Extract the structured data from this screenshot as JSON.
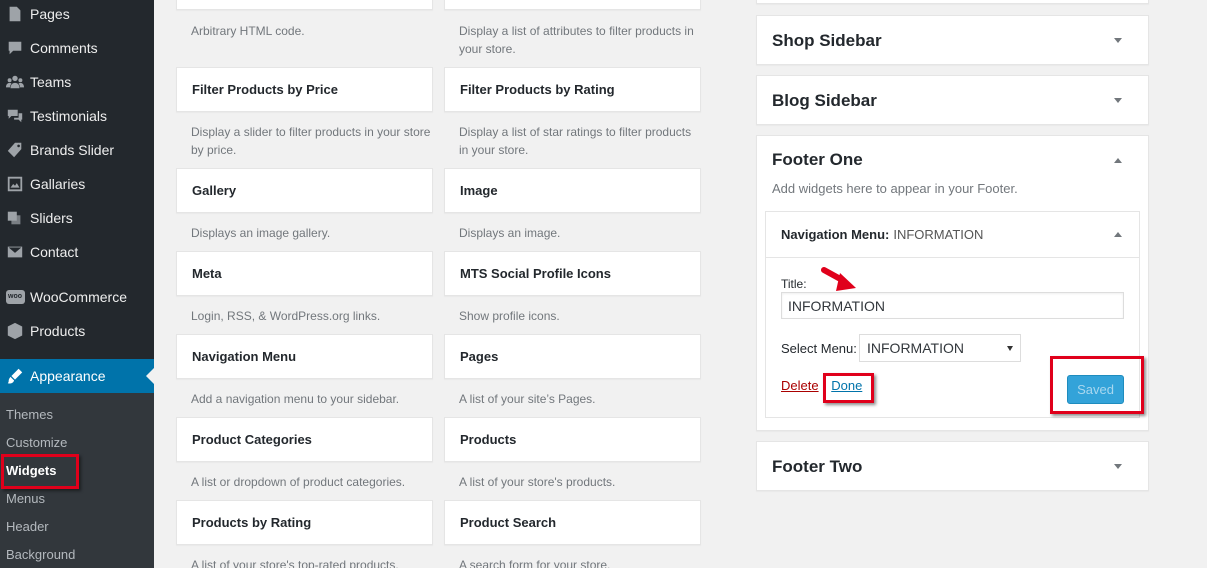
{
  "sidebar": {
    "items": [
      {
        "label": "Pages",
        "icon": "pages-icon"
      },
      {
        "label": "Comments",
        "icon": "comments-icon"
      },
      {
        "label": "Teams",
        "icon": "teams-icon"
      },
      {
        "label": "Testimonials",
        "icon": "testimonials-icon"
      },
      {
        "label": "Brands Slider",
        "icon": "tag-icon"
      },
      {
        "label": "Gallaries",
        "icon": "gallery-icon"
      },
      {
        "label": "Sliders",
        "icon": "sliders-icon"
      },
      {
        "label": "Contact",
        "icon": "mail-icon"
      },
      {
        "label": "WooCommerce",
        "icon": "woo-icon"
      },
      {
        "label": "Products",
        "icon": "box-icon"
      },
      {
        "label": "Appearance",
        "icon": "brush-icon"
      }
    ],
    "submenu": [
      "Themes",
      "Customize",
      "Widgets",
      "Menus",
      "Header",
      "Background"
    ],
    "woo_badge": "woo"
  },
  "widgets": {
    "top_descs": [
      "Arbitrary HTML code.",
      "Display a list of attributes to filter products in your store."
    ],
    "items": [
      {
        "title": "Filter Products by Price",
        "desc": "Display a slider to filter products in your store by price."
      },
      {
        "title": "Filter Products by Rating",
        "desc": "Display a list of star ratings to filter products in your store."
      },
      {
        "title": "Gallery",
        "desc": "Displays an image gallery."
      },
      {
        "title": "Image",
        "desc": "Displays an image."
      },
      {
        "title": "Meta",
        "desc": "Login, RSS, & WordPress.org links."
      },
      {
        "title": "MTS Social Profile Icons",
        "desc": "Show profile icons."
      },
      {
        "title": "Navigation Menu",
        "desc": "Add a navigation menu to your sidebar."
      },
      {
        "title": "Pages",
        "desc": "A list of your site’s Pages."
      },
      {
        "title": "Product Categories",
        "desc": "A list or dropdown of product categories."
      },
      {
        "title": "Products",
        "desc": "A list of your store's products."
      },
      {
        "title": "Products by Rating",
        "desc": "A list of your store's top-rated products."
      },
      {
        "title": "Product Search",
        "desc": "A search form for your store."
      }
    ]
  },
  "sidebars": {
    "shop": "Shop Sidebar",
    "blog": "Blog Sidebar",
    "footer_one": "Footer One",
    "footer_one_desc": "Add widgets here to appear in your Footer.",
    "footer_two": "Footer Two"
  },
  "nav_widget": {
    "header_label": "Navigation Menu:",
    "header_title": "INFORMATION",
    "title_label": "Title:",
    "title_value": "INFORMATION",
    "select_label": "Select Menu:",
    "select_value": "INFORMATION",
    "delete_label": "Delete",
    "separator": "|",
    "done_label": "Done",
    "save_label": "Saved"
  },
  "colors": {
    "admin_bar": "#23282d",
    "accent": "#0073aa",
    "highlight": "#e0001b",
    "save_button": "#33a3d9"
  }
}
